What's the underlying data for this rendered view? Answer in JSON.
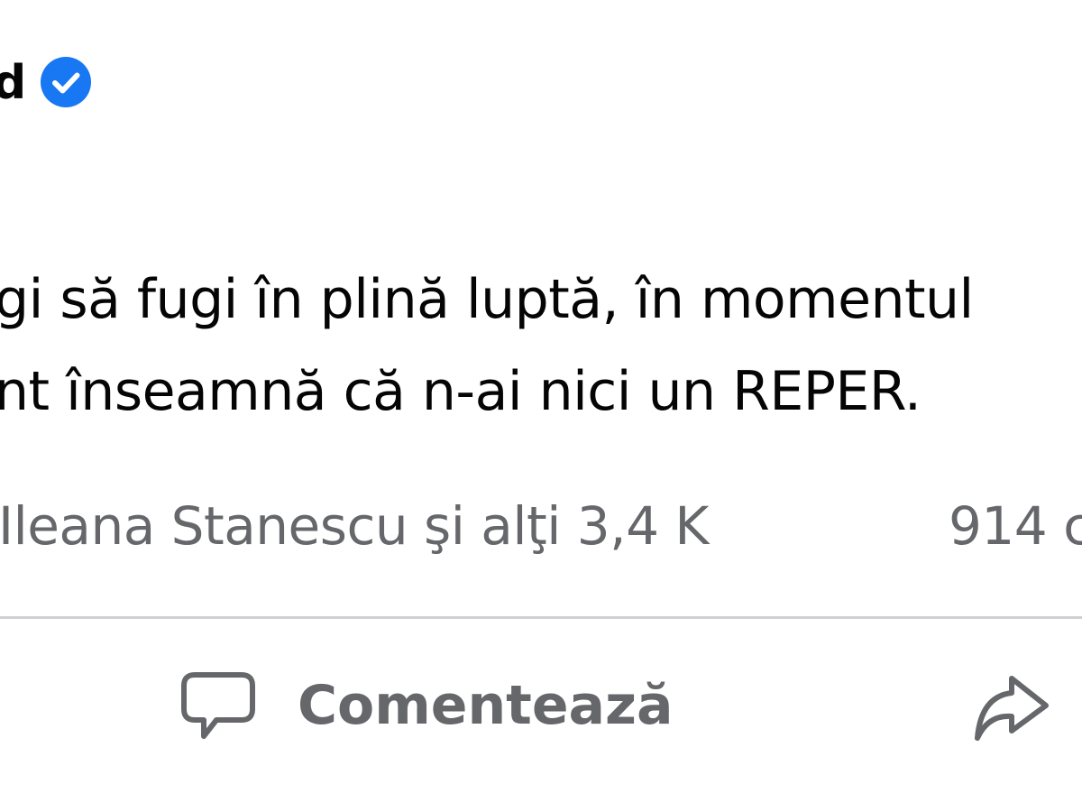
{
  "post": {
    "author_fragment": "d",
    "verified_icon": "verified-check-icon",
    "text_lines": [
      "gi să fugi în plină luptă, în momentul",
      "nt înseamnă că n-ai nici un REPER."
    ]
  },
  "reactions": {
    "summary": "Ileana Stanescu şi alţi 3,4 K",
    "comments_fragment": "914 c"
  },
  "actions": {
    "comment_label": "Comentează",
    "comment_icon": "comment-bubble-icon",
    "share_icon": "share-arrow-icon"
  },
  "colors": {
    "verified": "#1877f2",
    "primary_text": "#050505",
    "secondary_text": "#65676b",
    "divider": "#ced0d4"
  }
}
